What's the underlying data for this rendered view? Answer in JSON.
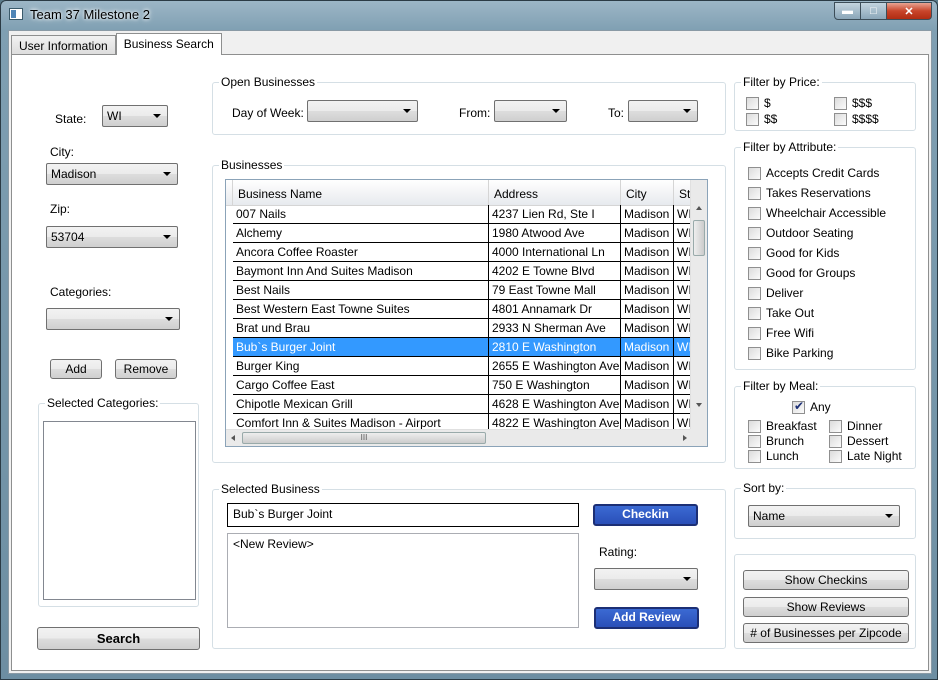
{
  "window": {
    "title": "Team 37 Milestone 2"
  },
  "tabs": [
    {
      "label": "User Information"
    },
    {
      "label": "Business Search"
    }
  ],
  "location": {
    "state_label": "State:",
    "state_value": "WI",
    "city_label": "City:",
    "city_value": "Madison",
    "zip_label": "Zip:",
    "zip_value": "53704",
    "categories_label": "Categories:",
    "categories_value": "",
    "add_label": "Add",
    "remove_label": "Remove",
    "selected_categories_label": "Selected Categories:",
    "search_label": "Search"
  },
  "open_businesses": {
    "label": "Open Businesses",
    "day_label": "Day of Week:",
    "day_value": "",
    "from_label": "From:",
    "from_value": "",
    "to_label": "To:",
    "to_value": ""
  },
  "businesses": {
    "label": "Businesses",
    "columns": [
      "Business Name",
      "Address",
      "City",
      "State"
    ],
    "columns_visible": [
      "Business Name",
      "Address",
      "City",
      "St"
    ],
    "rows": [
      [
        "007 Nails",
        "4237 Lien Rd, Ste I",
        "Madison",
        "WI"
      ],
      [
        "Alchemy",
        "1980 Atwood Ave",
        "Madison",
        "WI"
      ],
      [
        "Ancora Coffee Roaster",
        "4000 International Ln",
        "Madison",
        "WI"
      ],
      [
        "Baymont Inn And Suites Madison",
        "4202 E Towne Blvd",
        "Madison",
        "WI"
      ],
      [
        "Best Nails",
        "79 East Towne Mall",
        "Madison",
        "WI"
      ],
      [
        "Best Western East Towne Suites",
        "4801 Annamark Dr",
        "Madison",
        "WI"
      ],
      [
        "Brat und Brau",
        "2933 N Sherman Ave",
        "Madison",
        "WI"
      ],
      [
        "Bub`s Burger Joint",
        "2810 E Washington",
        "Madison",
        "WI"
      ],
      [
        "Burger King",
        "2655 E Washington Ave",
        "Madison",
        "WI"
      ],
      [
        "Cargo Coffee East",
        "750 E Washington",
        "Madison",
        "WI"
      ],
      [
        "Chipotle Mexican Grill",
        "4628 E Washington Ave",
        "Madison",
        "WI"
      ],
      [
        "Comfort Inn & Suites Madison - Airport",
        "4822 E Washington Ave",
        "Madison",
        "WI"
      ]
    ],
    "selected_row": 7,
    "scroll_grip": "III"
  },
  "selected_business": {
    "label": "Selected Business",
    "name": "Bub`s Burger Joint",
    "checkin_label": "Checkin",
    "review_placeholder": "<New Review>",
    "rating_label": "Rating:",
    "rating_value": "",
    "add_review_label": "Add Review"
  },
  "filter_price": {
    "label": "Filter by Price:",
    "options": [
      {
        "label": "$",
        "checked": false
      },
      {
        "label": "$$$",
        "checked": false
      },
      {
        "label": "$$",
        "checked": false
      },
      {
        "label": "$$$$",
        "checked": false
      }
    ]
  },
  "filter_attribute": {
    "label": "Filter by Attribute:",
    "options": [
      {
        "label": "Accepts Credit Cards",
        "checked": false
      },
      {
        "label": "Takes Reservations",
        "checked": false
      },
      {
        "label": "Wheelchair Accessible",
        "checked": false
      },
      {
        "label": "Outdoor Seating",
        "checked": false
      },
      {
        "label": "Good for Kids",
        "checked": false
      },
      {
        "label": "Good for Groups",
        "checked": false
      },
      {
        "label": "Deliver",
        "checked": false
      },
      {
        "label": "Take Out",
        "checked": false
      },
      {
        "label": "Free Wifi",
        "checked": false
      },
      {
        "label": "Bike Parking",
        "checked": false
      }
    ]
  },
  "filter_meal": {
    "label": "Filter by Meal:",
    "any": {
      "label": "Any",
      "checked": true
    },
    "options": [
      {
        "label": "Breakfast",
        "checked": false
      },
      {
        "label": "Dinner",
        "checked": false
      },
      {
        "label": "Brunch",
        "checked": false
      },
      {
        "label": "Dessert",
        "checked": false
      },
      {
        "label": "Lunch",
        "checked": false
      },
      {
        "label": "Late Night",
        "checked": false
      }
    ]
  },
  "sort": {
    "label": "Sort by:",
    "value": "Name"
  },
  "actions": {
    "show_checkins": "Show Checkins",
    "show_reviews": "Show Reviews",
    "per_zip": "# of Businesses per Zipcode"
  }
}
